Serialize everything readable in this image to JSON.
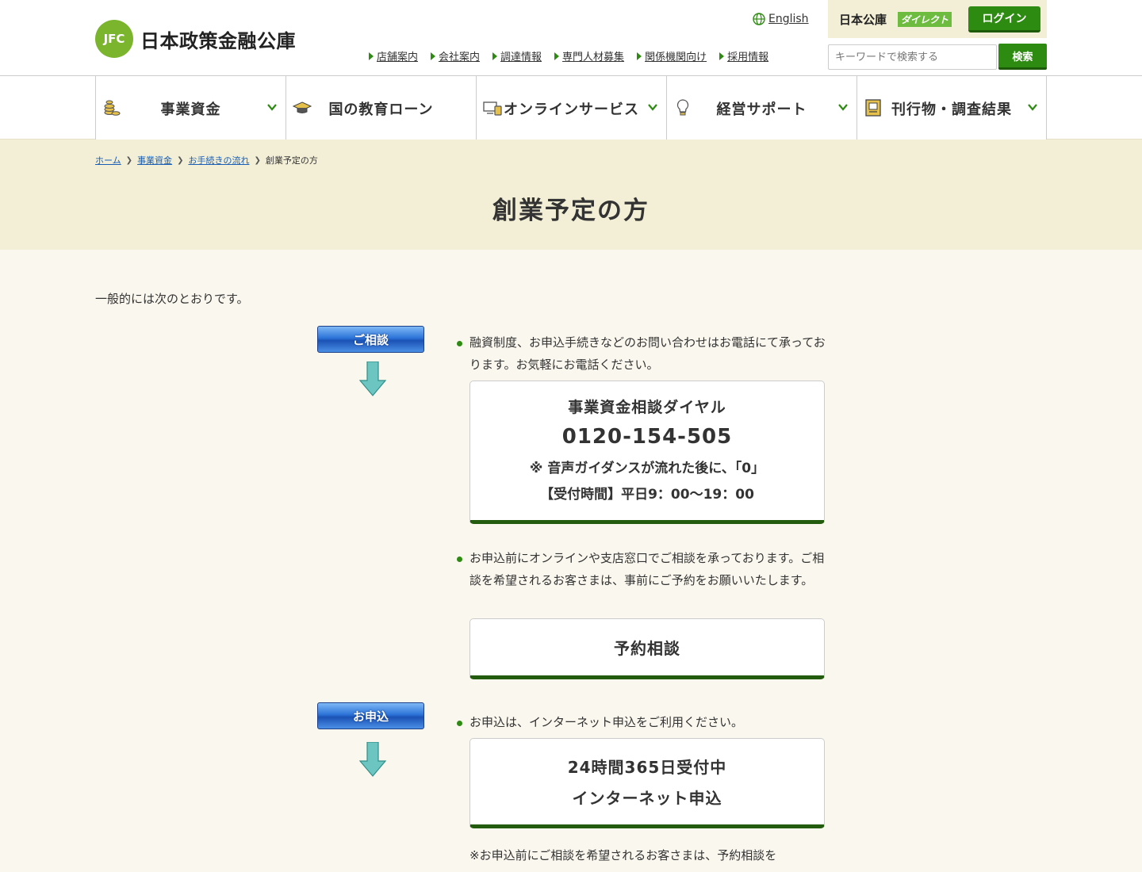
{
  "header": {
    "logo_mark": "JFC",
    "logo_text": "日本政策金融公庫",
    "lang_label": "English",
    "direct_name": "日本公庫",
    "direct_tag": "ダイレクト",
    "login_label": "ログイン",
    "util_links": [
      "店舗案内",
      "会社案内",
      "調達情報",
      "専門人材募集",
      "関係機関向け",
      "採用情報"
    ],
    "search_placeholder": "キーワードで検索する",
    "search_button": "検索"
  },
  "gnav": [
    {
      "label": "事業資金",
      "icon": "coins-icon",
      "has_dropdown": true
    },
    {
      "label": "国の教育ローン",
      "icon": "mortarboard-icon",
      "has_dropdown": false
    },
    {
      "label": "オンラインサービス",
      "icon": "devices-icon",
      "has_dropdown": true
    },
    {
      "label": "経営サポート",
      "icon": "lightbulb-icon",
      "has_dropdown": true
    },
    {
      "label": "刊行物・調査結果",
      "icon": "document-icon",
      "has_dropdown": true
    }
  ],
  "breadcrumb": {
    "links": [
      "ホーム",
      "事業資金",
      "お手続きの流れ"
    ],
    "current": "創業予定の方"
  },
  "page_title": "創業予定の方",
  "intro": "一般的には次のとおりです。",
  "steps": {
    "consult": {
      "badge": "ご相談",
      "bullet1": "融資制度、お申込手続きなどのお問い合わせはお電話にて承っております。お気軽にお電話ください。",
      "dial_title": "事業資金相談ダイヤル",
      "dial_number": "0120-154-505",
      "dial_note": "※ 音声ガイダンスが流れた後に、「0」",
      "dial_hours": "【受付時間】平日9：00〜19：00",
      "bullet2": "お申込前にオンラインや支店窓口でご相談を承っております。ご相談を希望されるお客さまは、事前にご予約をお願いいたします。",
      "reserve_label": "予約相談"
    },
    "apply": {
      "badge": "お申込",
      "bullet": "お申込は、インターネット申込をご利用ください。",
      "card_line1": "24時間365日受付中",
      "card_line2": "インターネット申込",
      "footnote": "※お申込前にご相談を希望されるお客さまは、予約相談を"
    }
  },
  "colors": {
    "brand_green": "#2e8b12",
    "hero_bg": "#f3efd6",
    "page_bg": "#faf7ee",
    "badge_blue": "#2c74d8",
    "arrow_teal": "#6cc5c0"
  }
}
